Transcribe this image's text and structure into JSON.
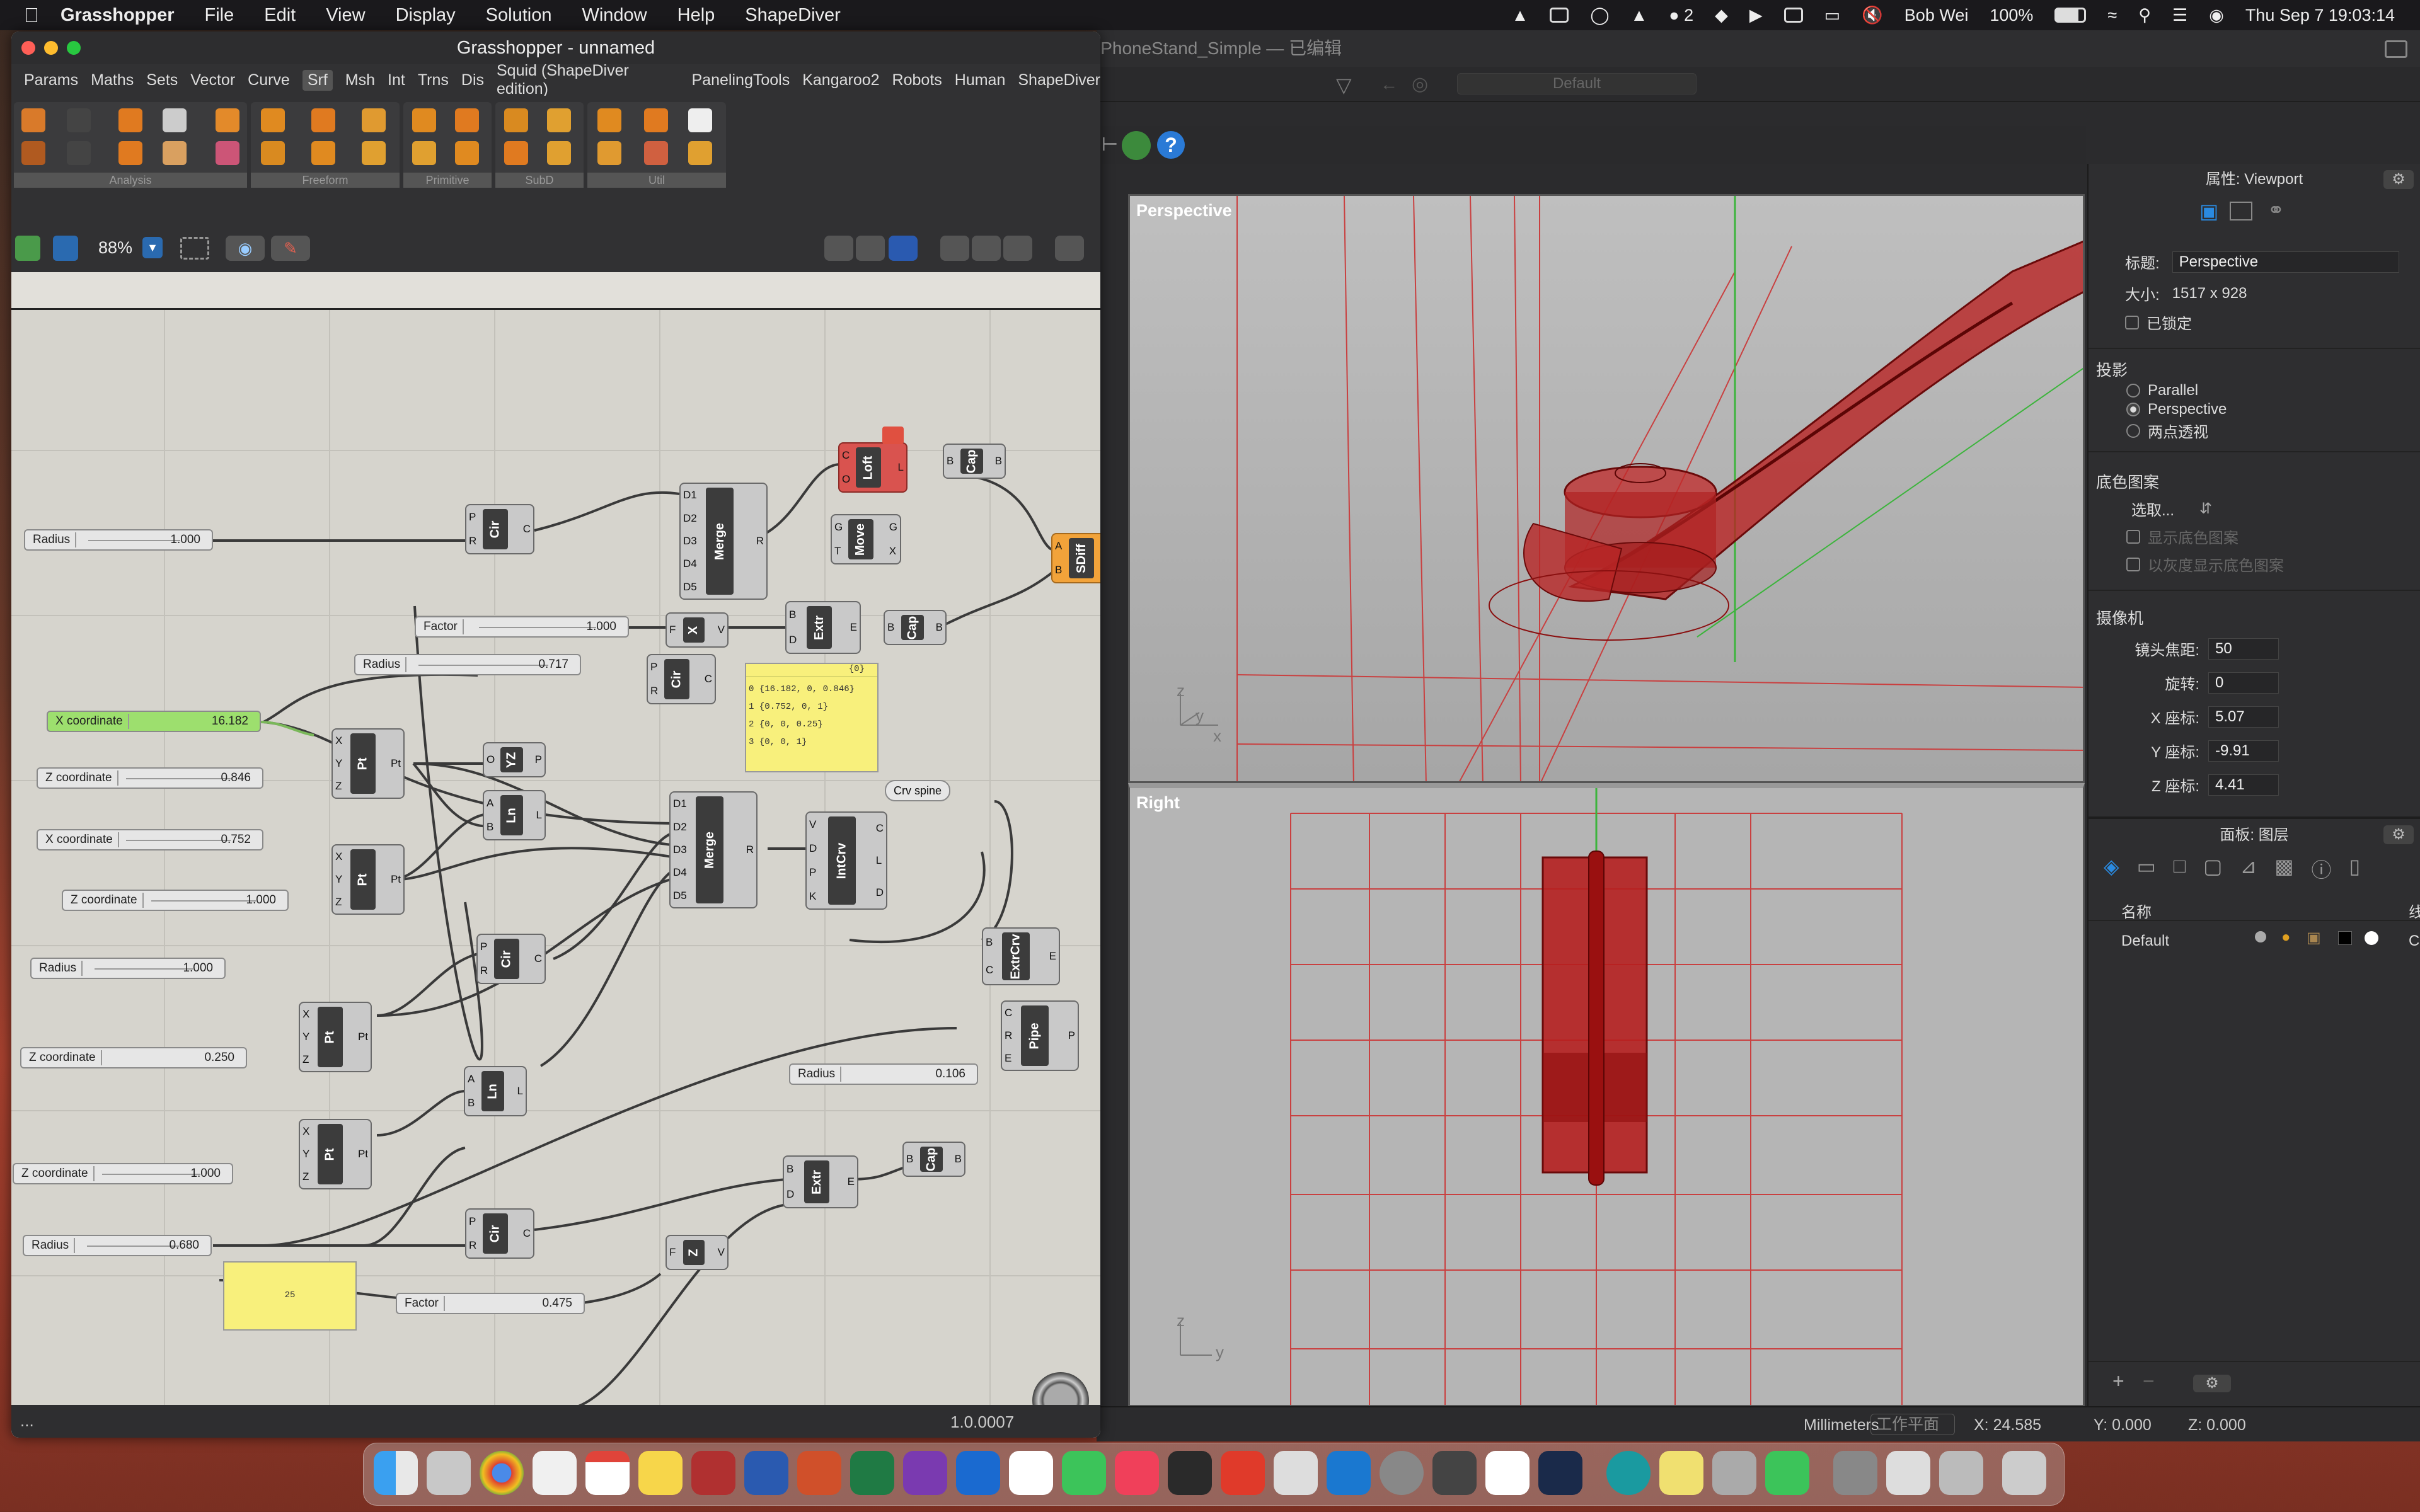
{
  "menubar": {
    "app": "Grasshopper",
    "items": [
      "File",
      "Edit",
      "View",
      "Display",
      "Solution",
      "Window",
      "Help",
      "ShapeDiver"
    ],
    "user": "Bob Wei",
    "battery": "100%",
    "datetime": "Thu Sep 7  19:03:14",
    "wechat_count": "2"
  },
  "rhino": {
    "title": "iPhoneStand_Simple — 已编辑",
    "display_mode": "Default",
    "units": "Millimeters",
    "cplane": "工作平面",
    "x": "X: 24.585",
    "y": "Y: 0.000",
    "z": "Z: 0.000",
    "viewport_top": "Perspective",
    "viewport_bottom": "Right",
    "axis_x": "x",
    "axis_y": "y",
    "axis_z": "z"
  },
  "properties": {
    "header": "属性: Viewport",
    "title_label": "标题:",
    "title_value": "Perspective",
    "size_label": "大小:",
    "size_value": "1517 x 928",
    "locked": "已锁定",
    "projection": "投影",
    "proj_options": [
      "Parallel",
      "Perspective",
      "两点透视"
    ],
    "background": "底色图案",
    "select": "选取...",
    "show_bg": "显示底色图案",
    "gray_bg": "以灰度显示底色图案",
    "camera": "摄像机",
    "lens_label": "镜头焦距:",
    "lens": "50",
    "rot_label": "旋转:",
    "rot": "0",
    "x_label": "X 座标:",
    "x": "5.07",
    "y_label": "Y 座标:",
    "y": "-9.91",
    "z_label": "Z 座标:",
    "z": "4.41",
    "layers_header": "面板: 图层",
    "name_col": "名称",
    "line_col": "线",
    "layer": "Default",
    "layer_trunc": "Co"
  },
  "gh": {
    "title": "Grasshopper - unnamed",
    "tabs": [
      "Params",
      "Maths",
      "Sets",
      "Vector",
      "Curve",
      "Srf",
      "Msh",
      "Int",
      "Trns",
      "Dis",
      "Squid (ShapeDiver edition)",
      "PanelingTools",
      "Kangaroo2",
      "Robots",
      "Human",
      "ShapeDiver"
    ],
    "groups": [
      "Analysis",
      "Freeform",
      "Primitive",
      "SubD",
      "Util"
    ],
    "zoom": "88%",
    "version": "1.0.0007",
    "status_left": "...",
    "sliders": [
      {
        "label": "Radius",
        "value": "1.000"
      },
      {
        "label": "Factor",
        "value": "1.000"
      },
      {
        "label": "Radius",
        "value": "0.717"
      },
      {
        "label": "X coordinate",
        "value": "16.182"
      },
      {
        "label": "Z coordinate",
        "value": "0.846"
      },
      {
        "label": "X coordinate",
        "value": "0.752"
      },
      {
        "label": "Z coordinate",
        "value": "1.000"
      },
      {
        "label": "Radius",
        "value": "1.000"
      },
      {
        "label": "Z coordinate",
        "value": "0.250"
      },
      {
        "label": "Radius",
        "value": "0.106"
      },
      {
        "label": "Z coordinate",
        "value": "1.000"
      },
      {
        "label": "Radius",
        "value": "0.680"
      },
      {
        "label": "Factor",
        "value": "0.475"
      }
    ],
    "panel_header": "{0}",
    "panel_lines": [
      "0 {16.182, 0, 0.846}",
      "1 {0.752, 0, 1}",
      "2 {0, 0, 0.25}",
      "3 {0, 0, 1}"
    ],
    "panel2": "25",
    "param_crv": "Crv spine",
    "components": {
      "cir": "Cir",
      "merge": "Merge",
      "loft": "Loft",
      "cap": "Cap",
      "move": "Move",
      "sdiff": "SDiff",
      "x": "X",
      "extr": "Extr",
      "pt": "Pt",
      "yz": "YZ",
      "ln": "Ln",
      "intcrv": "IntCrv",
      "extrcrv": "ExtrCrv",
      "pipe": "Pipe",
      "z": "Z"
    }
  }
}
